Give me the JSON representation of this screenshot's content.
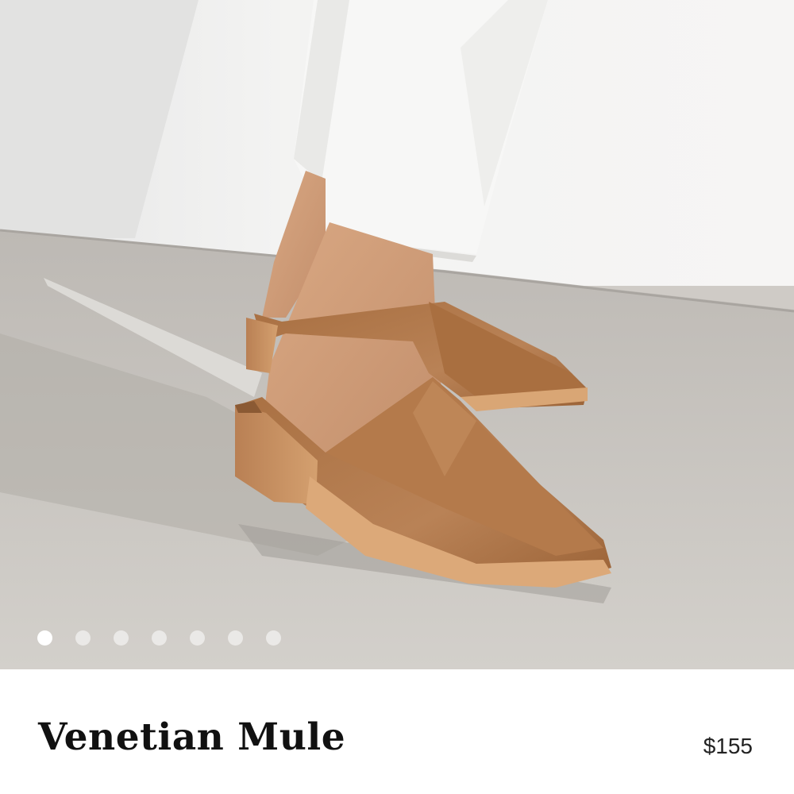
{
  "product": {
    "image_alt": "Tan leather pointed-toe mules with stacked wooden heels worn with white cropped pants on concrete",
    "title": "Venetian Mule",
    "price": "$155"
  },
  "carousel": {
    "count": 7,
    "active_index": 0
  },
  "colors": {
    "leather": "#b07a4c",
    "heel_wood": "#c79463",
    "wall": "#f1f0ee",
    "concrete": "#c9c5c0"
  }
}
